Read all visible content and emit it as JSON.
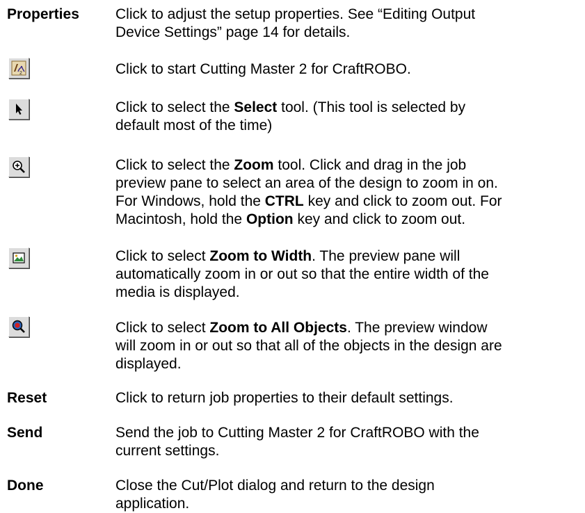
{
  "rows": {
    "properties": {
      "term": "Properties",
      "desc_line1": "Click to adjust the setup properties. See “Editing Output",
      "desc_line2": "Device Settings” page 14 for details."
    },
    "cutting_master": {
      "icon": "cutting-master-icon",
      "desc": "Click to start Cutting Master 2 for CraftROBO."
    },
    "select": {
      "icon": "arrow-pointer-icon",
      "p1": "Click to select the ",
      "bold": "Select",
      "p2": " tool. (This tool is selected by",
      "line2": "default most of the time)"
    },
    "zoom": {
      "icon": "magnifier-plus-icon",
      "l1a": "Click to select the ",
      "l1b": "Zoom",
      "l1c": " tool. Click and drag in the job",
      "l2": "preview pane to select an area of the design to zoom in on.",
      "l3a": "For Windows, hold the ",
      "l3b": "CTRL",
      "l3c": " key and click to zoom out. For",
      "l4a": "Macintosh, hold the ",
      "l4b": "Option",
      "l4c": " key and click to zoom out."
    },
    "zoom_width": {
      "icon": "zoom-to-width-icon",
      "l1a": "Click to select ",
      "l1b": "Zoom to Width",
      "l1c": ". The preview pane will",
      "l2": "automatically zoom in or out so that the entire width of the",
      "l3": "media is displayed."
    },
    "zoom_all": {
      "icon": "zoom-to-all-objects-icon",
      "l1a": "Click to select ",
      "l1b": "Zoom to All Objects",
      "l1c": ". The preview window",
      "l2": "will zoom in or out so that all of the objects in the design are",
      "l3": "displayed."
    },
    "reset": {
      "term": "Reset",
      "desc": "Click to return job properties to their default settings."
    },
    "send": {
      "term": "Send",
      "l1": "Send the job to Cutting Master 2 for CraftROBO with the",
      "l2": "current settings."
    },
    "done": {
      "term": "Done",
      "l1": "Close the Cut/Plot dialog and return to the design",
      "l2": "application."
    }
  }
}
